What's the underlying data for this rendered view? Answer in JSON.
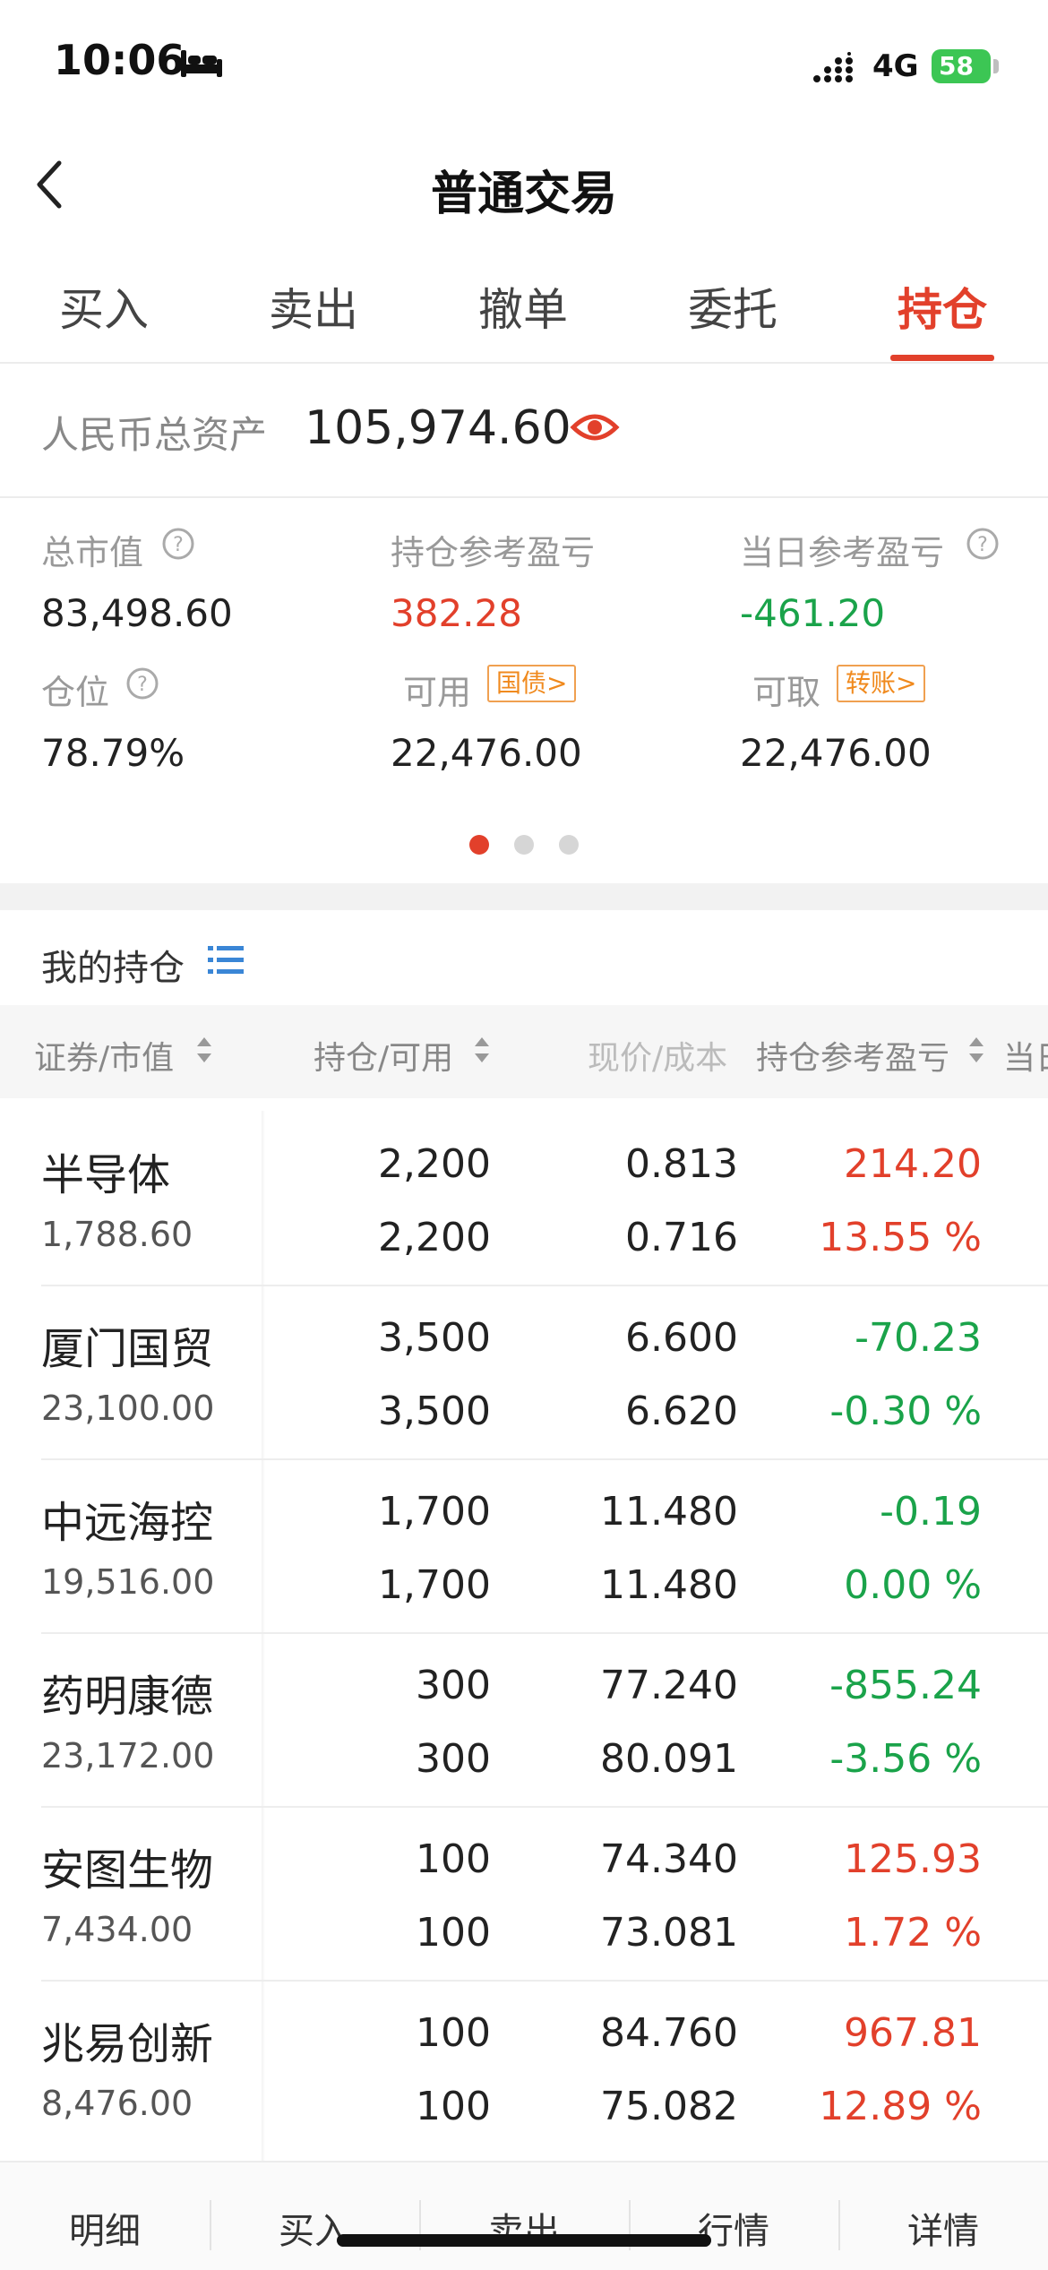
{
  "status_bar": {
    "time": "10:06",
    "network": "4G",
    "battery": "58"
  },
  "nav": {
    "title": "普通交易"
  },
  "tabs": [
    {
      "label": "买入"
    },
    {
      "label": "卖出"
    },
    {
      "label": "撤单"
    },
    {
      "label": "委托"
    },
    {
      "label": "持仓"
    }
  ],
  "assets": {
    "label": "人民币总资产",
    "value": "105,974.60",
    "stats": {
      "market_value": {
        "label": "总市值",
        "value": "83,498.60"
      },
      "position_pnl": {
        "label": "持仓参考盈亏",
        "value": "382.28"
      },
      "daily_pnl": {
        "label": "当日参考盈亏",
        "value": "-461.20"
      },
      "position_ratio": {
        "label": "仓位",
        "value": "78.79%"
      },
      "available": {
        "label": "可用",
        "tag": "国债>",
        "value": "22,476.00"
      },
      "withdrawable": {
        "label": "可取",
        "tag": "转账>",
        "value": "22,476.00"
      }
    }
  },
  "holdings": {
    "title": "我的持仓",
    "columns": [
      "证券/市值",
      "持仓/可用",
      "现价/成本",
      "持仓参考盈亏",
      "当日"
    ],
    "rows": [
      {
        "name": "半导体",
        "market_value": "1,788.60",
        "position": "2,200",
        "available": "2,200",
        "price": "0.813",
        "cost": "0.716",
        "pnl": "214.20",
        "pnl_pct": "13.55 %"
      },
      {
        "name": "厦门国贸",
        "market_value": "23,100.00",
        "position": "3,500",
        "available": "3,500",
        "price": "6.600",
        "cost": "6.620",
        "pnl": "-70.23",
        "pnl_pct": "-0.30 %"
      },
      {
        "name": "中远海控",
        "market_value": "19,516.00",
        "position": "1,700",
        "available": "1,700",
        "price": "11.480",
        "cost": "11.480",
        "pnl": "-0.19",
        "pnl_pct": "0.00 %"
      },
      {
        "name": "药明康德",
        "market_value": "23,172.00",
        "position": "300",
        "available": "300",
        "price": "77.240",
        "cost": "80.091",
        "pnl": "-855.24",
        "pnl_pct": "-3.56 %"
      },
      {
        "name": "安图生物",
        "market_value": "7,434.00",
        "position": "100",
        "available": "100",
        "price": "74.340",
        "cost": "73.081",
        "pnl": "125.93",
        "pnl_pct": "1.72 %"
      },
      {
        "name": "兆易创新",
        "market_value": "8,476.00",
        "position": "100",
        "available": "100",
        "price": "84.760",
        "cost": "75.082",
        "pnl": "967.81",
        "pnl_pct": "12.89 %"
      }
    ]
  },
  "bottom_bar": {
    "items": [
      "明细",
      "买入",
      "卖出",
      "行情",
      "详情"
    ]
  },
  "colors": {
    "accent": "#e2402b",
    "loss": "#1aa34a",
    "tag": "#f08a1e"
  }
}
